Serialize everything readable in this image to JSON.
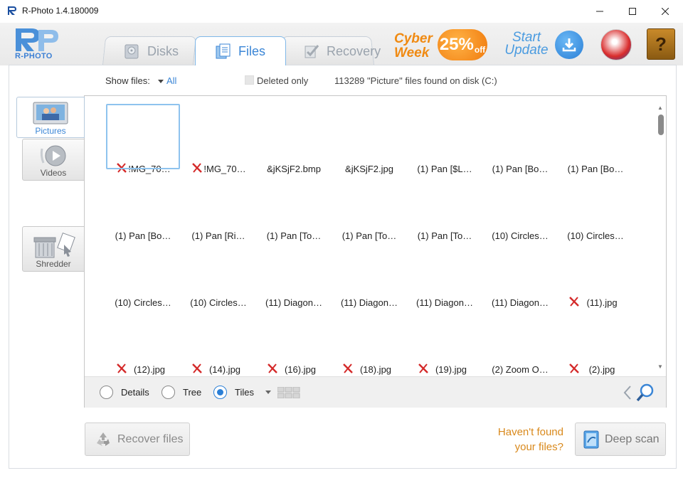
{
  "window": {
    "title": "R-Photo 1.4.180009",
    "minimize_icon": "minimize-icon",
    "maximize_icon": "maximize-icon",
    "close_icon": "close-icon"
  },
  "header": {
    "logo_text": "R-PHOTO",
    "tabs": [
      {
        "label": "Disks",
        "icon": "disk-icon",
        "active": false
      },
      {
        "label": "Files",
        "icon": "files-icon",
        "active": true
      },
      {
        "label": "Recovery",
        "icon": "recovery-check-icon",
        "active": false
      }
    ],
    "promo": {
      "line1": "Cyber",
      "line2": "Week",
      "percent": "25%",
      "off": "off"
    },
    "start_update": {
      "line1": "Start",
      "line2": "Update"
    },
    "help_symbol": "?"
  },
  "filters": {
    "show_files_label": "Show files:",
    "show_files_value": "All",
    "deleted_only_label": "Deleted only",
    "found_text": "113289 \"Picture\" files found on disk (C:)"
  },
  "sidebar": {
    "items": [
      {
        "label": "Pictures",
        "active": true
      },
      {
        "label": "Videos",
        "active": false
      },
      {
        "label": "Shredder",
        "active": false
      }
    ]
  },
  "files": {
    "rows": [
      [
        {
          "name": "!MG_70…",
          "deleted": true
        },
        {
          "name": "!MG_70…",
          "deleted": true
        },
        {
          "name": "&jKSjF2.bmp",
          "deleted": false
        },
        {
          "name": "&jKSjF2.jpg",
          "deleted": false
        },
        {
          "name": "(1) Pan [$L…",
          "deleted": false
        },
        {
          "name": "(1) Pan [Bo…",
          "deleted": false
        },
        {
          "name": "(1) Pan [Bo…",
          "deleted": false
        }
      ],
      [
        {
          "name": "(1) Pan [Bo…",
          "deleted": false
        },
        {
          "name": "(1) Pan [Ri…",
          "deleted": false
        },
        {
          "name": "(1) Pan [To…",
          "deleted": false
        },
        {
          "name": "(1) Pan [To…",
          "deleted": false
        },
        {
          "name": "(1) Pan [To…",
          "deleted": false
        },
        {
          "name": "(10) Circles…",
          "deleted": false
        },
        {
          "name": "(10) Circles…",
          "deleted": false
        }
      ],
      [
        {
          "name": "(10) Circles…",
          "deleted": false
        },
        {
          "name": "(10) Circles…",
          "deleted": false
        },
        {
          "name": "(11) Diagon…",
          "deleted": false
        },
        {
          "name": "(11) Diagon…",
          "deleted": false
        },
        {
          "name": "(11) Diagon…",
          "deleted": false
        },
        {
          "name": "(11) Diagon…",
          "deleted": false
        },
        {
          "name": "(11).jpg",
          "deleted": true
        }
      ],
      [
        {
          "name": "(12).jpg",
          "deleted": true
        },
        {
          "name": "(14).jpg",
          "deleted": true
        },
        {
          "name": "(16).jpg",
          "deleted": true
        },
        {
          "name": "(18).jpg",
          "deleted": true
        },
        {
          "name": "(19).jpg",
          "deleted": true
        },
        {
          "name": "(2) Zoom O…",
          "deleted": false
        },
        {
          "name": "(2).jpg",
          "deleted": true
        }
      ]
    ]
  },
  "view": {
    "details_label": "Details",
    "tree_label": "Tree",
    "tiles_label": "Tiles",
    "selected": "Tiles"
  },
  "bottom": {
    "recover_label": "Recover files",
    "havent_found_line1": "Haven't found",
    "havent_found_line2": "your files?",
    "deep_scan_label": "Deep scan"
  },
  "colors": {
    "accent": "#3b86d6",
    "promo": "#f08a12",
    "hint": "#d9891c",
    "delete_mark": "#d42a2a"
  }
}
